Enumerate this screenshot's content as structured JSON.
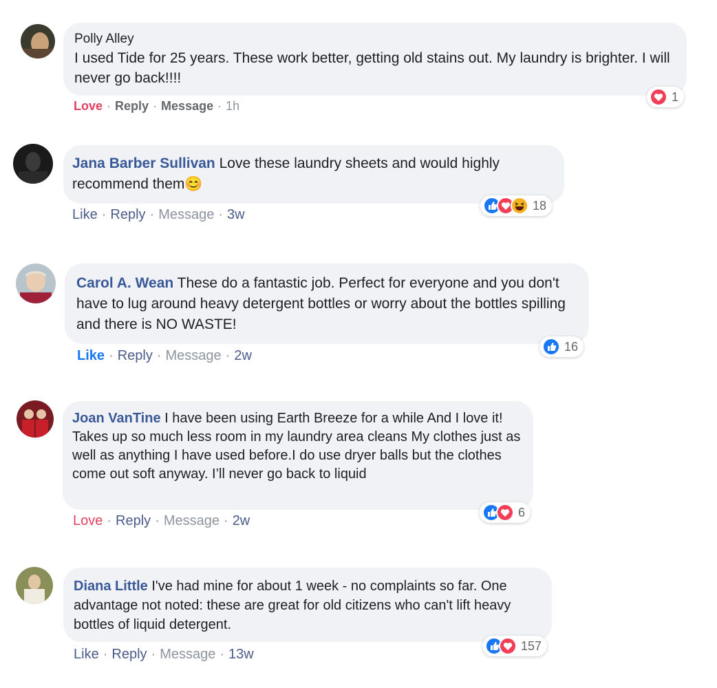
{
  "comments": [
    {
      "name": "Polly Alley",
      "text": "I used Tide for 25 years. These work better, getting old stains out. My laundry is brighter. I will never go back!!!!",
      "actions": {
        "a1": "Love",
        "a2": "Reply",
        "a3": "Message",
        "time": "1h"
      },
      "reaction_count": "1",
      "reaction_icons": [
        "heart-icon"
      ]
    },
    {
      "name": "Jana Barber Sullivan",
      "text": "Love these laundry sheets and would highly recommend them😊",
      "actions": {
        "a1": "Like",
        "a2": "Reply",
        "a3": "Message",
        "time": "3w"
      },
      "reaction_count": "18",
      "reaction_icons": [
        "like-icon",
        "heart-icon",
        "haha-icon"
      ]
    },
    {
      "name": "Carol A. Wean",
      "text": "These do a fantastic job. Perfect for everyone and you don't have to lug around heavy detergent bottles or worry about the bottles spilling and there is NO WASTE!",
      "actions": {
        "a1": "Like",
        "a2": "Reply",
        "a3": "Message",
        "time": "2w"
      },
      "reaction_count": "16",
      "reaction_icons": [
        "like-icon"
      ]
    },
    {
      "name": "Joan VanTine",
      "text": "I have been using Earth Breeze for a while And I love it! Takes up so much less room in my laundry area cleans My clothes just as well as anything I have used before.I do use dryer balls but the clothes come out soft anyway. I’ll never go back to liquid",
      "actions": {
        "a1": "Love",
        "a2": "Reply",
        "a3": "Message",
        "time": "2w"
      },
      "reaction_count": "6",
      "reaction_icons": [
        "like-icon",
        "heart-icon"
      ]
    },
    {
      "name": "Diana Little",
      "text": "I've had mine for about 1 week - no complaints so far. One advantage not noted: these are great for old citizens who can't lift heavy bottles of liquid detergent.",
      "actions": {
        "a1": "Like",
        "a2": "Reply",
        "a3": "Message",
        "time": "13w"
      },
      "reaction_count": "157",
      "reaction_icons": [
        "like-icon",
        "heart-icon"
      ]
    }
  ],
  "colors": {
    "bubble": "#f0f2f5",
    "name": "#385898",
    "love": "#e4405f",
    "like": "#1877f2",
    "meta": "#8d949e"
  }
}
